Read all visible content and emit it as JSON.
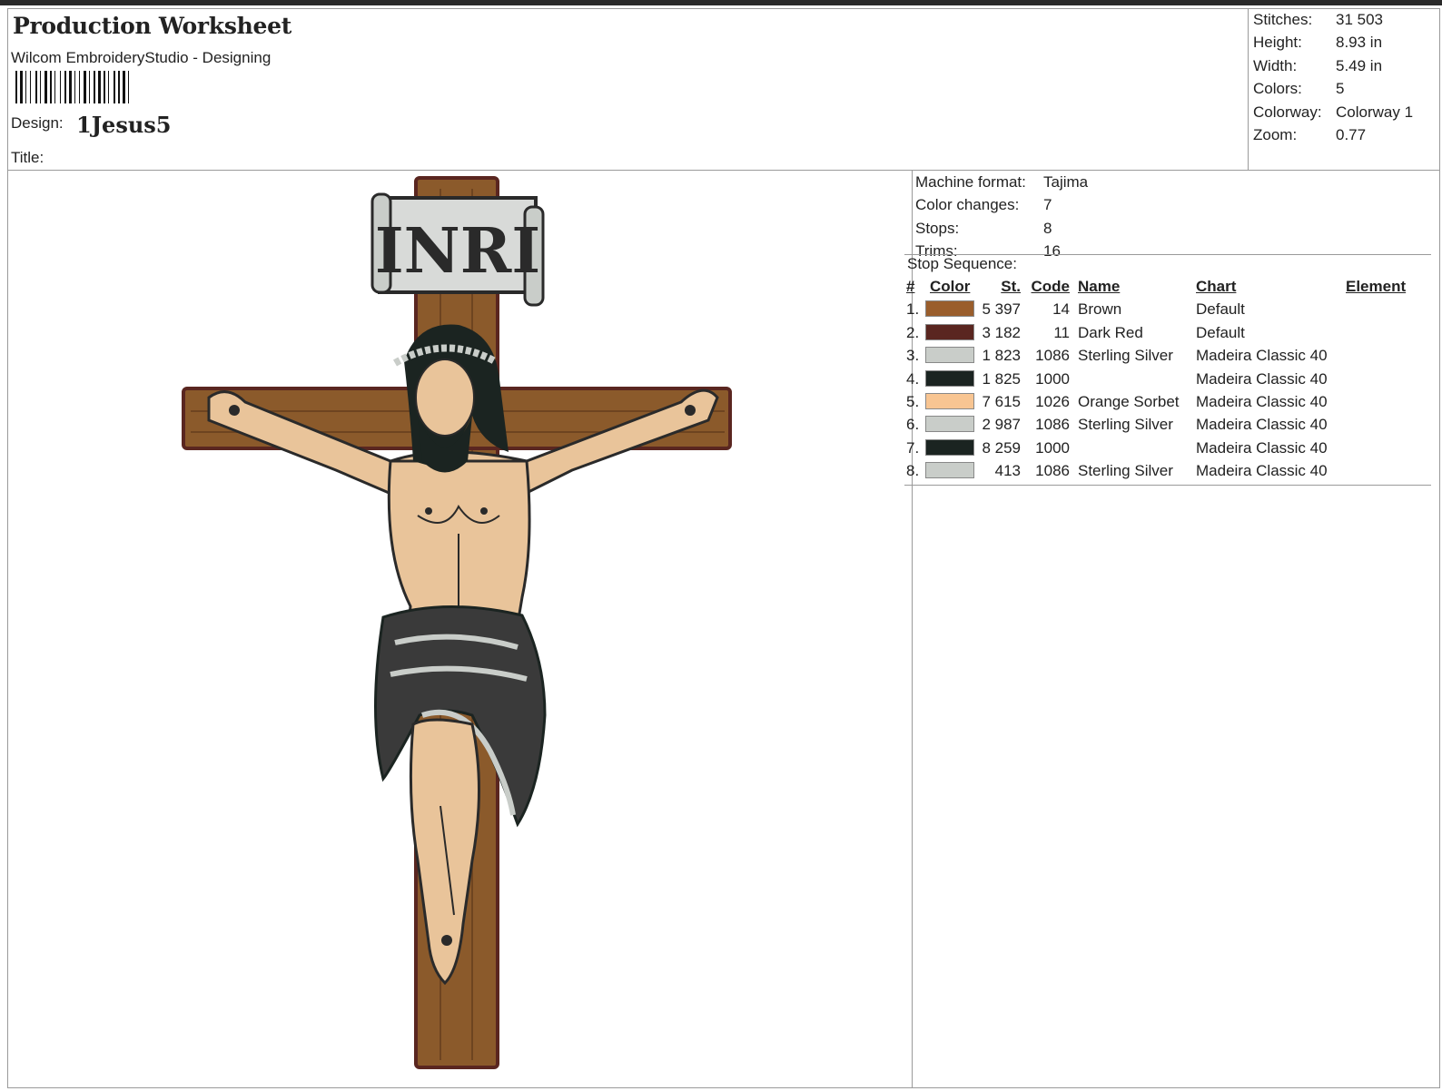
{
  "header": {
    "title": "Production Worksheet",
    "subtitle": "Wilcom EmbroideryStudio - Designing",
    "design_label": "Design:",
    "design_name": "1Jesus5",
    "title_label": "Title:"
  },
  "stats": [
    {
      "label": "Stitches:",
      "value": "31 503"
    },
    {
      "label": "Height:",
      "value": "8.93 in"
    },
    {
      "label": "Width:",
      "value": "5.49 in"
    },
    {
      "label": "Colors:",
      "value": "5"
    },
    {
      "label": "Colorway:",
      "value": "Colorway 1"
    },
    {
      "label": "Zoom:",
      "value": "0.77"
    }
  ],
  "machine_info": [
    {
      "label": "Machine format:",
      "value": "Tajima"
    },
    {
      "label": "Color changes:",
      "value": "7"
    },
    {
      "label": "Stops:",
      "value": "8"
    },
    {
      "label": "Trims:",
      "value": "16"
    }
  ],
  "stop_sequence": {
    "label": "Stop Sequence:",
    "headers": {
      "num": "#",
      "color": "Color",
      "st": "St.",
      "code": "Code",
      "name": "Name",
      "chart": "Chart",
      "element": "Element"
    },
    "rows": [
      {
        "num": "1.",
        "color": "#9a5e2c",
        "st": "5 397",
        "code": "14",
        "name": "Brown",
        "chart": "Default"
      },
      {
        "num": "2.",
        "color": "#5a2620",
        "st": "3 182",
        "code": "11",
        "name": "Dark Red",
        "chart": "Default"
      },
      {
        "num": "3.",
        "color": "#c9cdc9",
        "st": "1 823",
        "code": "1086",
        "name": "Sterling Silver",
        "chart": "Madeira Classic 40"
      },
      {
        "num": "4.",
        "color": "#1b2421",
        "st": "1 825",
        "code": "1000",
        "name": "",
        "chart": "Madeira Classic 40"
      },
      {
        "num": "5.",
        "color": "#f8c592",
        "st": "7 615",
        "code": "1026",
        "name": "Orange Sorbet",
        "chart": "Madeira Classic 40"
      },
      {
        "num": "6.",
        "color": "#c9cdc9",
        "st": "2 987",
        "code": "1086",
        "name": "Sterling Silver",
        "chart": "Madeira Classic 40"
      },
      {
        "num": "7.",
        "color": "#1b2421",
        "st": "8 259",
        "code": "1000",
        "name": "",
        "chart": "Madeira Classic 40"
      },
      {
        "num": "8.",
        "color": "#c9cdc9",
        "st": "413",
        "code": "1086",
        "name": "Sterling Silver",
        "chart": "Madeira Classic 40"
      }
    ]
  },
  "artwork": {
    "sign_text": "INRI",
    "colors": {
      "wood": "#8b5a2b",
      "wood_dark": "#5a2620",
      "skin": "#e9c49a",
      "cloth": "#3a3a3a",
      "silver": "#c9cdc9"
    }
  }
}
